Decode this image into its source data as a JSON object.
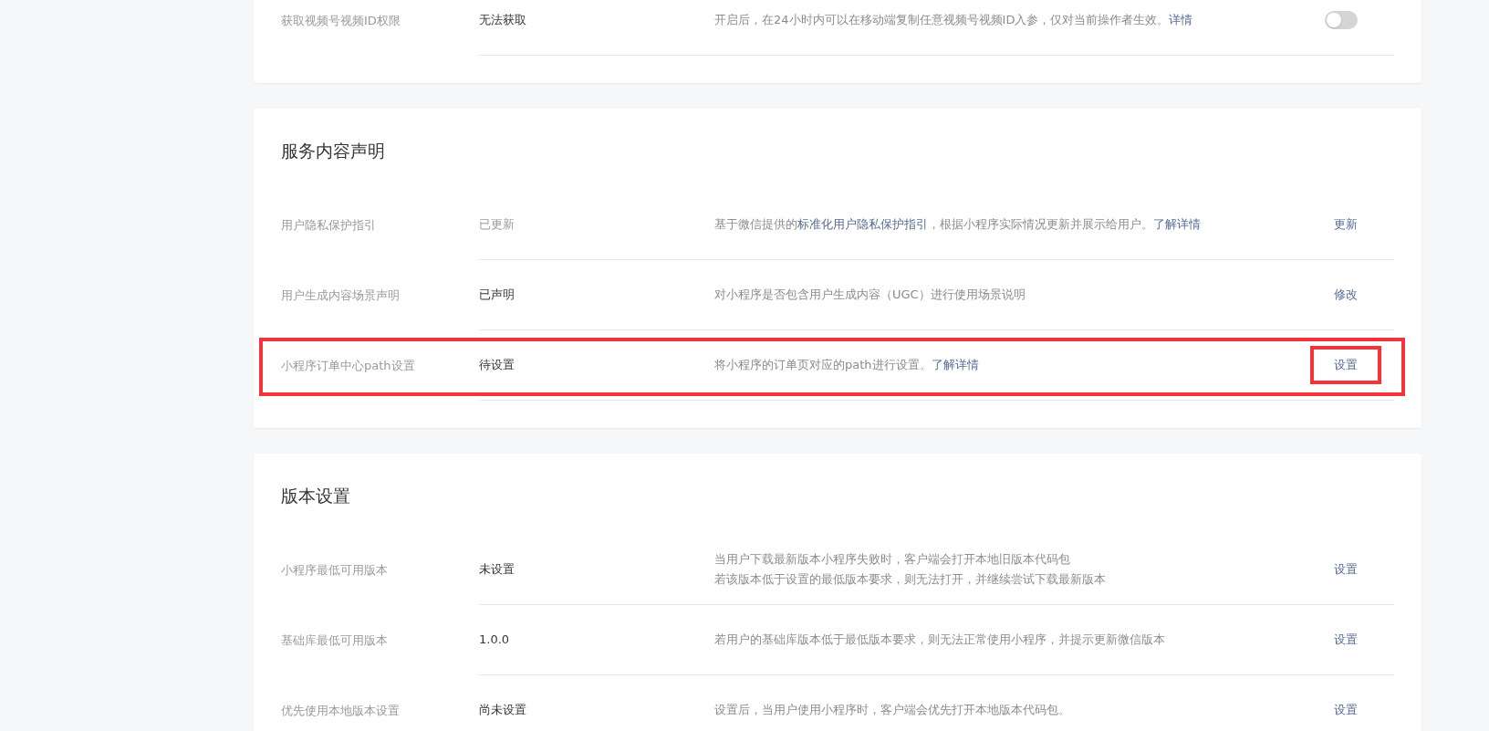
{
  "sections": [
    {
      "rows": [
        {
          "label": "获取视频号视频ID权限",
          "value": "无法获取",
          "value_muted": false,
          "description": [
            {
              "text": "开启后，在24小时内可以在移动端复制任意视频号视频ID入参，仅对当前操作者生效。",
              "link": false
            },
            {
              "text": "详情",
              "link": true
            }
          ],
          "action": {
            "kind": "toggle",
            "on": false
          },
          "highlighted": false
        }
      ]
    },
    {
      "title": "服务内容声明",
      "rows": [
        {
          "label": "用户隐私保护指引",
          "value": "已更新",
          "value_muted": true,
          "description": [
            {
              "text": "基于微信提供的",
              "link": false
            },
            {
              "text": "标准化用户隐私保护指引",
              "link": true
            },
            {
              "text": "，根据小程序实际情况更新并展示给用户。",
              "link": false
            },
            {
              "text": "了解详情",
              "link": true
            }
          ],
          "action": {
            "kind": "link",
            "text": "更新"
          },
          "highlighted": false
        },
        {
          "label": "用户生成内容场景声明",
          "value": "已声明",
          "value_muted": false,
          "description": [
            {
              "text": "对小程序是否包含用户生成内容（UGC）进行使用场景说明",
              "link": false
            }
          ],
          "action": {
            "kind": "link",
            "text": "修改"
          },
          "highlighted": false
        },
        {
          "label": "小程序订单中心path设置",
          "value": "待设置",
          "value_muted": false,
          "description": [
            {
              "text": "将小程序的订单页对应的path进行设置。",
              "link": false
            },
            {
              "text": "了解详情",
              "link": true
            }
          ],
          "action": {
            "kind": "link",
            "text": "设置"
          },
          "highlighted": true
        }
      ]
    },
    {
      "title": "版本设置",
      "rows": [
        {
          "label": "小程序最低可用版本",
          "value": "未设置",
          "value_muted": false,
          "description": [
            {
              "text": "当用户下载最新版本小程序失败时，客户端会打开本地旧版本代码包",
              "link": false
            },
            {
              "text": "若该版本低于设置的最低版本要求，则无法打开，并继续尝试下载最新版本",
              "link": false,
              "newline": true
            }
          ],
          "action": {
            "kind": "link",
            "text": "设置"
          },
          "highlighted": false
        },
        {
          "label": "基础库最低可用版本",
          "value": "1.0.0",
          "value_muted": false,
          "description": [
            {
              "text": "若用户的基础库版本低于最低版本要求，则无法正常使用小程序，并提示更新微信版本",
              "link": false
            }
          ],
          "action": {
            "kind": "link",
            "text": "设置"
          },
          "highlighted": false
        },
        {
          "label": "优先使用本地版本设置",
          "value": "尚未设置",
          "value_muted": false,
          "description": [
            {
              "text": "设置后，当用户使用小程序时，客户端会优先打开本地版本代码包。",
              "link": false
            }
          ],
          "action": {
            "kind": "link",
            "text": "设置"
          },
          "highlighted": false
        }
      ]
    }
  ]
}
